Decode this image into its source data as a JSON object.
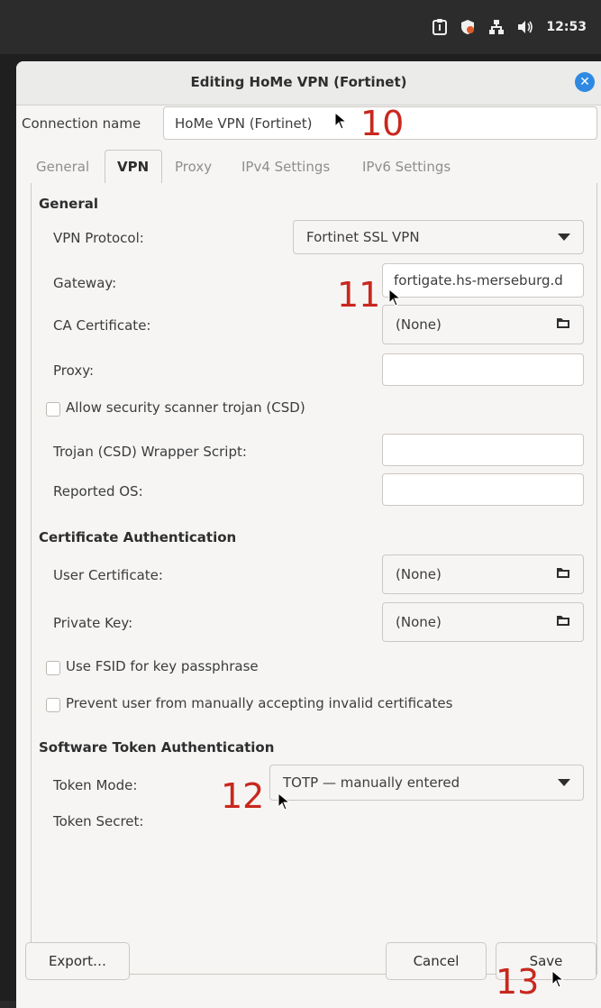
{
  "system": {
    "clock": "12:53"
  },
  "dialog": {
    "title": "Editing HoMe VPN (Fortinet)",
    "connection_name_label": "Connection name",
    "connection_name_value": "HoMe VPN (Fortinet)",
    "tabs": [
      {
        "label": "General"
      },
      {
        "label": "VPN"
      },
      {
        "label": "Proxy"
      },
      {
        "label": "IPv4 Settings"
      },
      {
        "label": "IPv6 Settings"
      }
    ],
    "general": {
      "heading": "General",
      "vpn_protocol_label": "VPN Protocol:",
      "vpn_protocol_value": "Fortinet SSL VPN",
      "gateway_label": "Gateway:",
      "gateway_value": "fortigate.hs-merseburg.d",
      "ca_label": "CA Certificate:",
      "ca_value": "(None)",
      "proxy_label": "Proxy:",
      "proxy_value": "",
      "csd_label": "Allow security scanner trojan (CSD)",
      "csd_script_label": "Trojan (CSD) Wrapper Script:",
      "csd_script_value": "",
      "reported_os_label": "Reported OS:",
      "reported_os_value": ""
    },
    "cert_auth": {
      "heading": "Certificate Authentication",
      "user_cert_label": "User Certificate:",
      "user_cert_value": "(None)",
      "private_key_label": "Private Key:",
      "private_key_value": "(None)",
      "fsid_label": "Use FSID for key passphrase",
      "prevent_label": "Prevent user from manually accepting invalid certificates"
    },
    "token_auth": {
      "heading": "Software Token Authentication",
      "token_mode_label": "Token Mode:",
      "token_mode_value": "TOTP — manually entered",
      "token_secret_label": "Token Secret:"
    },
    "buttons": {
      "export": "Export…",
      "cancel": "Cancel",
      "save": "Save"
    }
  },
  "annotations": {
    "a10": "10",
    "a11": "11",
    "a12": "12",
    "a13": "13"
  },
  "colors": {
    "accent": "#2f89e2",
    "annotation": "#c8281e"
  }
}
